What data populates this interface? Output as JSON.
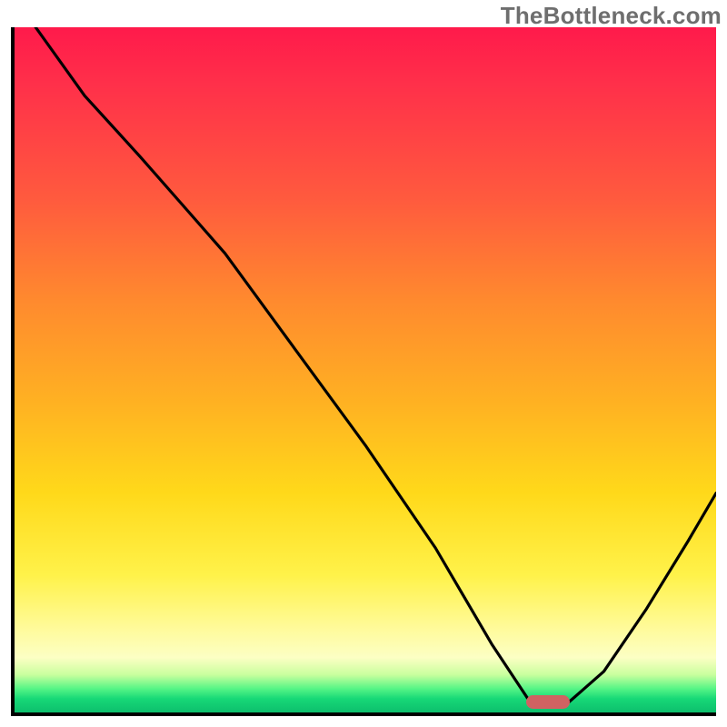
{
  "watermark": "TheBottleneck.com",
  "chart_data": {
    "type": "line",
    "title": "",
    "xlabel": "",
    "ylabel": "",
    "xlim": [
      0,
      100
    ],
    "ylim": [
      0,
      100
    ],
    "grid": false,
    "background": {
      "type": "vertical-gradient",
      "stops": [
        {
          "pos": 0,
          "color": "#ff1a4b"
        },
        {
          "pos": 25,
          "color": "#ff5a3e"
        },
        {
          "pos": 55,
          "color": "#ffb222"
        },
        {
          "pos": 80,
          "color": "#fff24a"
        },
        {
          "pos": 92,
          "color": "#fcffc4"
        },
        {
          "pos": 100,
          "color": "#0dbf6d"
        }
      ]
    },
    "series": [
      {
        "name": "bottleneck-curve",
        "x": [
          3,
          10,
          18,
          24,
          30,
          40,
          50,
          60,
          68,
          73.5,
          79,
          84,
          90,
          96,
          100
        ],
        "y": [
          100,
          90,
          81,
          74,
          67,
          53,
          39,
          24,
          10,
          1.5,
          1.5,
          6,
          15,
          25,
          32
        ]
      }
    ],
    "annotations": [
      {
        "type": "pill",
        "name": "optimal-marker",
        "x": 76,
        "y": 1.5,
        "color": "#d06262"
      }
    ]
  }
}
